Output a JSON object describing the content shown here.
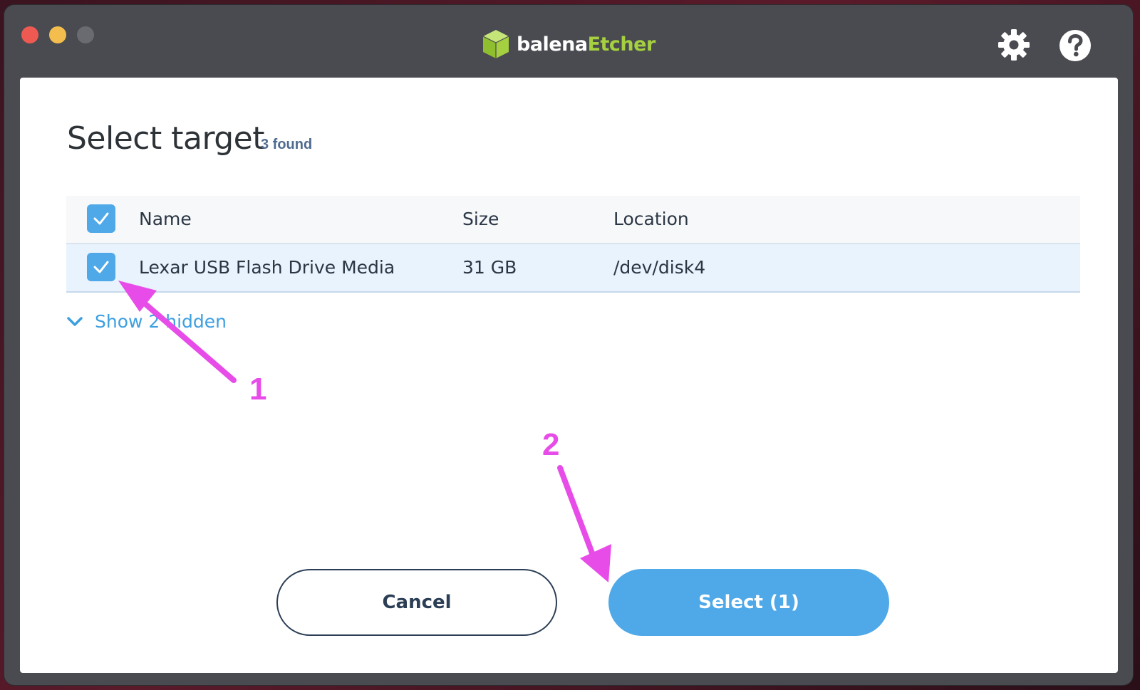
{
  "app": {
    "brand_prefix": "balena",
    "brand_suffix": "Etcher",
    "brand_color": "#a5d040",
    "icons": [
      "cube-logo-icon",
      "gear-icon",
      "help-icon"
    ]
  },
  "dialog": {
    "title": "Select target",
    "found_count": "3 found",
    "columns": [
      "Name",
      "Size",
      "Location"
    ],
    "drives": [
      {
        "name": "Lexar USB Flash Drive Media",
        "size": "31 GB",
        "location": "/dev/disk4",
        "checked": true
      }
    ],
    "show_hidden_label": "Show 2 hidden",
    "cancel_label": "Cancel",
    "select_label": "Select (1)",
    "accent_color": "#4fa8e8"
  },
  "annotations": {
    "step1": "1",
    "step2": "2",
    "color": "#e84ce8"
  }
}
